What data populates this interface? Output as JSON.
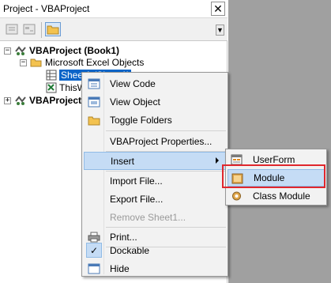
{
  "window": {
    "title": "Project - VBAProject",
    "close_glyph": "✕"
  },
  "toolbar": {
    "buttons": [
      "view-code-icon",
      "view-object-icon",
      "toggle-folders-icon"
    ],
    "scroll_glyph": "▼"
  },
  "tree": {
    "items": [
      {
        "label": "VBAProject (Book1)",
        "expander": "−"
      },
      {
        "label": "Microsoft Excel Objects",
        "expander": "−"
      },
      {
        "label": "Sheet1 (Sheet1)"
      },
      {
        "label": "ThisW"
      },
      {
        "label": "VBAProject",
        "expander": "+"
      }
    ]
  },
  "context_menu": {
    "items": [
      {
        "label": "View Code",
        "mnemonic": "d"
      },
      {
        "label": "View Object",
        "mnemonic": "b"
      },
      {
        "label": "Toggle Folders"
      },
      {
        "label": "VBAProject Properties..."
      },
      {
        "label": "Insert",
        "state": "hover"
      },
      {
        "label": "Import File..."
      },
      {
        "label": "Export File..."
      },
      {
        "label": "Remove Sheet1...",
        "state": "disabled"
      },
      {
        "label": "Print..."
      },
      {
        "label": "Dockable",
        "checked": true
      },
      {
        "label": "Hide"
      }
    ]
  },
  "insert_submenu": {
    "items": [
      {
        "label": "UserForm"
      },
      {
        "label": "Module",
        "state": "hover"
      },
      {
        "label": "Class Module"
      }
    ]
  },
  "colors": {
    "selection": "#0a64c8",
    "menu_hover": "#c5dcf5",
    "highlight_frame": "#e0272d",
    "workspace": "#a0a0a0"
  }
}
